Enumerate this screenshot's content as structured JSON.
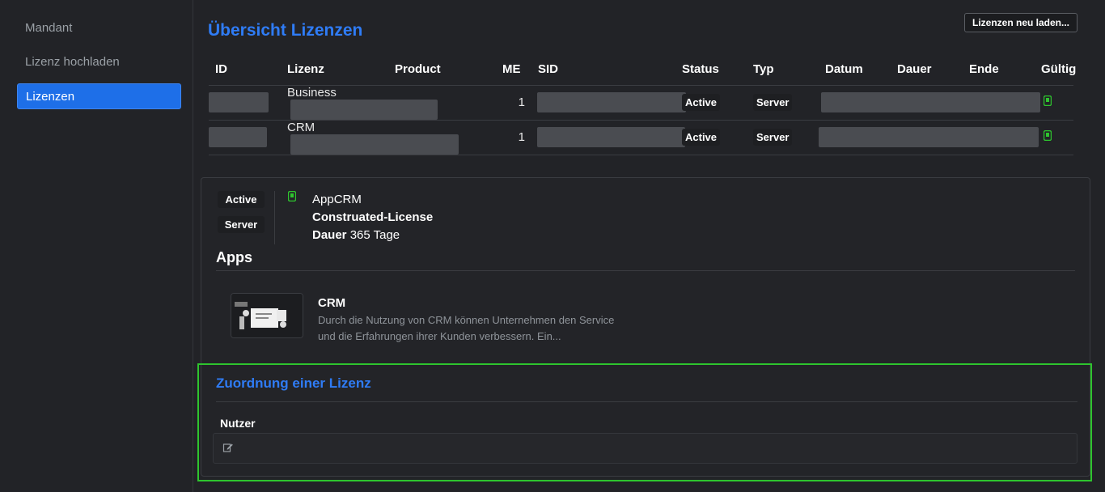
{
  "sidebar": {
    "items": [
      {
        "label": "Mandant"
      },
      {
        "label": "Lizenz hochladen"
      },
      {
        "label": "Lizenzen"
      }
    ]
  },
  "header": {
    "title": "Übersicht Lizenzen",
    "reload_label": "Lizenzen neu laden..."
  },
  "table": {
    "columns": [
      "ID",
      "Lizenz",
      "Product",
      "ME",
      "SID",
      "Status",
      "Typ",
      "Datum",
      "Dauer",
      "Ende",
      "Gültig"
    ],
    "rows": [
      {
        "lizenz": "Business",
        "me": "1",
        "status": "Active",
        "typ": "Server"
      },
      {
        "lizenz": "CRM",
        "me": "1",
        "status": "Active",
        "typ": "Server"
      }
    ]
  },
  "detail": {
    "status": "Active",
    "typ": "Server",
    "app": "AppCRM",
    "license_name": "Construated-License",
    "dauer_label": "Dauer",
    "dauer_value": "365 Tage",
    "apps_heading": "Apps",
    "app_card": {
      "name": "CRM",
      "description": "Durch die Nutzung von CRM können Unternehmen den Service und die Erfahrungen ihrer Kunden verbessern. Ein..."
    }
  },
  "assignment": {
    "title": "Zuordnung einer Lizenz",
    "nutzer_label": "Nutzer"
  },
  "colors": {
    "accent": "#2f7cf6",
    "active_nav": "#1e6fe8",
    "valid_green": "#2ec42e"
  },
  "icons": {
    "valid": "shield-check-icon",
    "edit": "edit-icon"
  }
}
